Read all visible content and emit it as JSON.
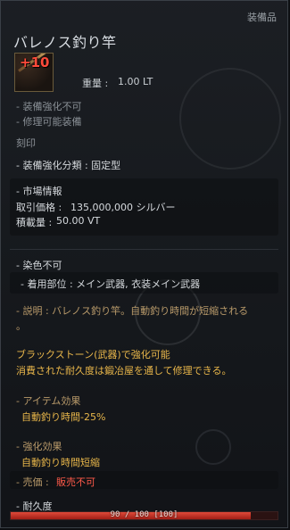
{
  "header": {
    "category": "装備品",
    "item_name": "バレノス釣り竿",
    "enhance_level": "+10",
    "weight_label": "重量 :",
    "weight_value": "1.00 LT"
  },
  "basic": {
    "not_enhanceable": "- 装備強化不可",
    "repairable": "- 修理可能装備",
    "engraving": "刻印"
  },
  "enhance_type": "- 装備強化分類 : 固定型",
  "market": {
    "title": "- 市場情報",
    "price_label": "取引価格 :",
    "price_value": "135,000,000 シルバー",
    "stock_label": "積載量 :",
    "stock_value": "50.00 VT"
  },
  "dye": {
    "title": "- 染色不可",
    "slot": "- 着用部位 : メイン武器, 衣装メイン武器"
  },
  "description": {
    "line1": "- 説明 : バレノス釣り竿。自動釣り時間が短縮される",
    "line2": "。"
  },
  "blackstone": {
    "line1": "ブラックストーン(武器)で強化可能",
    "line2": "消費された耐久度は鍛冶屋を通して修理できる。"
  },
  "item_effect": {
    "title": "- アイテム効果",
    "value": "自動釣り時間-25%"
  },
  "enhance_effect": {
    "title": "- 強化効果",
    "value": "自動釣り時間短縮"
  },
  "sell": {
    "label": "- 売価 :",
    "value": "販売不可"
  },
  "durability": {
    "title": "- 耐久度",
    "text": "90 / 100 [100]",
    "fraction": 0.9
  },
  "colors": {
    "bar": "#c42a1e",
    "gold_text": "#e8b64a",
    "red_text": "#ff5a4a"
  }
}
